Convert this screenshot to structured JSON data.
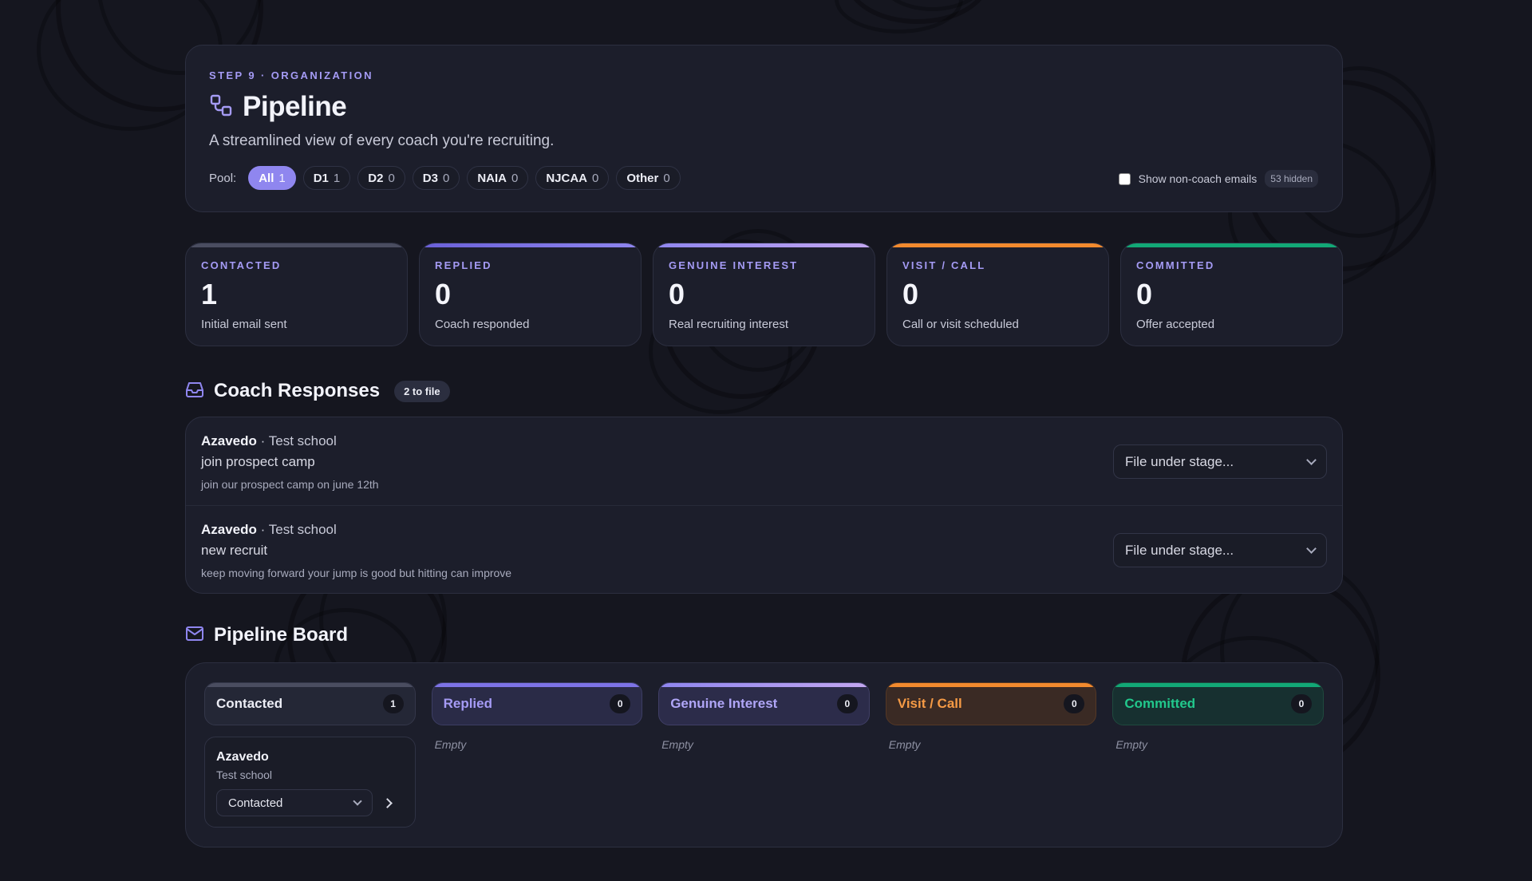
{
  "header": {
    "step_label": "STEP 9 · ORGANIZATION",
    "title": "Pipeline",
    "subtitle": "A streamlined view of every coach you're recruiting.",
    "pool_label": "Pool:",
    "pools": [
      {
        "label": "All",
        "count": "1",
        "active": true
      },
      {
        "label": "D1",
        "count": "1"
      },
      {
        "label": "D2",
        "count": "0"
      },
      {
        "label": "D3",
        "count": "0"
      },
      {
        "label": "NAIA",
        "count": "0"
      },
      {
        "label": "NJCAA",
        "count": "0"
      },
      {
        "label": "Other",
        "count": "0"
      }
    ],
    "noncoach_label": "Show non-coach emails",
    "hidden_badge": "53 hidden"
  },
  "stats": [
    {
      "label": "CONTACTED",
      "value": "1",
      "desc": "Initial email sent",
      "color": "#4a4d60"
    },
    {
      "label": "REPLIED",
      "value": "0",
      "desc": "Coach responded",
      "color": "#7d73e6"
    },
    {
      "label": "GENUINE INTEREST",
      "value": "0",
      "desc": "Real recruiting interest",
      "color": "#a99cf3"
    },
    {
      "label": "VISIT / CALL",
      "value": "0",
      "desc": "Call or visit scheduled",
      "color": "#f28a2e"
    },
    {
      "label": "COMMITTED",
      "value": "0",
      "desc": "Offer accepted",
      "color": "#12a876"
    }
  ],
  "responses": {
    "title": "Coach Responses",
    "badge": "2 to file",
    "items": [
      {
        "coach": "Azavedo",
        "school": "· Test school",
        "subject": "join prospect camp",
        "snippet": "join our prospect camp on june 12th",
        "select": "File under stage..."
      },
      {
        "coach": "Azavedo",
        "school": "· Test school",
        "subject": "new recruit",
        "snippet": "keep moving forward your jump is good but hitting can improve",
        "select": "File under stage..."
      }
    ]
  },
  "board": {
    "title": "Pipeline Board",
    "empty_label": "Empty",
    "columns": [
      {
        "label": "Contacted",
        "count": "1",
        "bar": "#4a4d60",
        "bg": "#242736",
        "text": "#ecedf5"
      },
      {
        "label": "Replied",
        "count": "0",
        "bar": "#7d73e6",
        "bg": "#2a2b47",
        "text": "#a59bf5"
      },
      {
        "label": "Genuine Interest",
        "count": "0",
        "bar": "#a99cf3",
        "bg": "#2c2c4a",
        "text": "#b0a6f7"
      },
      {
        "label": "Visit / Call",
        "count": "0",
        "bar": "#f28a2e",
        "bg": "#3a2a24",
        "text": "#f59a45"
      },
      {
        "label": "Committed",
        "count": "0",
        "bar": "#12a876",
        "bg": "#173030",
        "text": "#22c88c"
      }
    ],
    "card": {
      "name": "Azavedo",
      "school": "Test school",
      "stage": "Contacted"
    }
  }
}
